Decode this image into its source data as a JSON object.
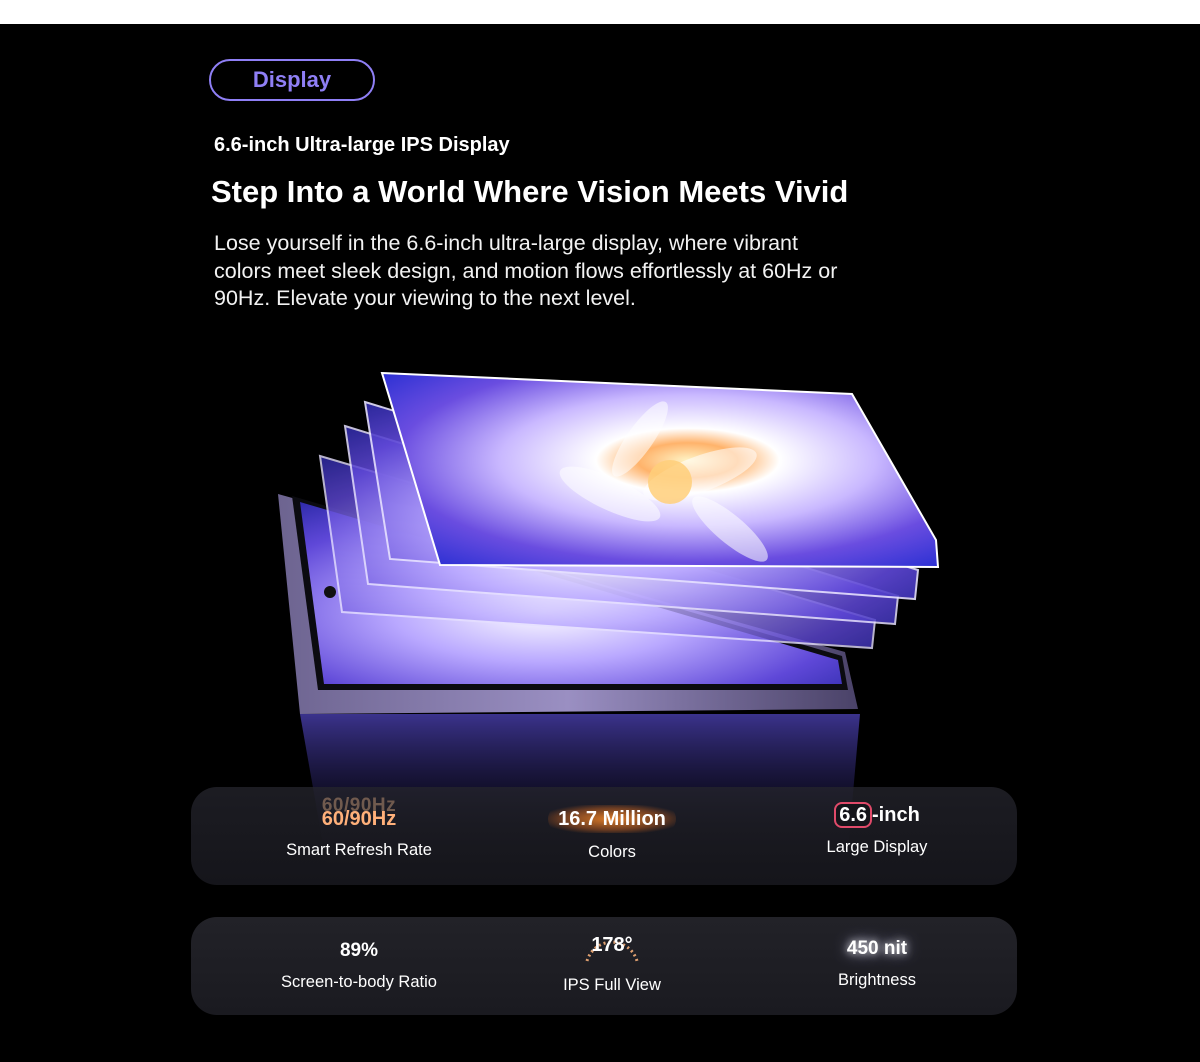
{
  "section_tag": "Display",
  "eyebrow": "6.6-inch Ultra-large IPS Display",
  "headline": "Step Into a World Where Vision Meets Vivid",
  "body_lines": [
    "Lose yourself in the 6.6-inch ultra-large display, where vibrant",
    "colors meet sleek design, and motion flows effortlessly at 60Hz or",
    "90Hz. Elevate your viewing to the next level."
  ],
  "specs_row_1": [
    {
      "value": "60/90Hz",
      "label": "Smart Refresh Rate"
    },
    {
      "value": "16.7 Million",
      "label": "Colors"
    },
    {
      "value_boxed": "6.6",
      "value_suffix": "-inch",
      "label": "Large Display"
    }
  ],
  "specs_row_2": [
    {
      "value": "89%",
      "label": "Screen-to-body Ratio"
    },
    {
      "value": "178°",
      "label": "IPS Full View"
    },
    {
      "value": "450 nit",
      "label": "Brightness"
    }
  ],
  "colors": {
    "accent": "#8f7ff5",
    "background": "#000000",
    "refresh_orange": "#ffb07a",
    "inch_box_border": "#e04a6a"
  }
}
